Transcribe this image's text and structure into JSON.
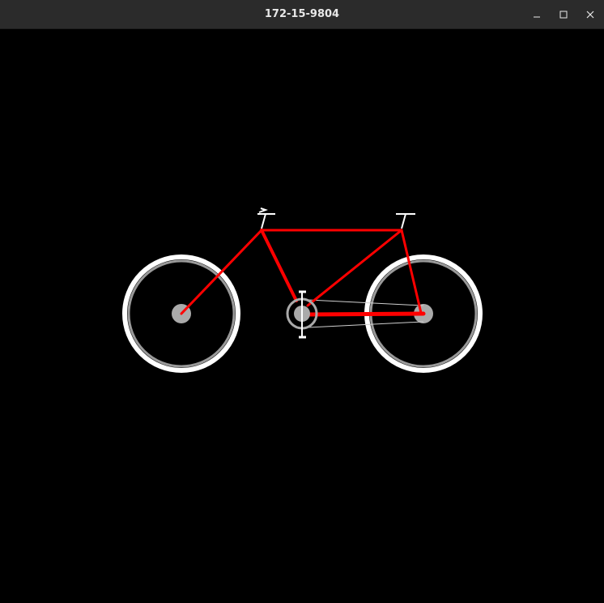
{
  "window": {
    "title": "172-15-9804",
    "controls": {
      "minimize_icon": "minimize-icon",
      "maximize_icon": "maximize-icon",
      "close_icon": "close-icon"
    }
  },
  "colors": {
    "titlebar": "#2b2b2b",
    "title_text": "#e8e8e8",
    "background": "#000000",
    "frame": "#ff0000",
    "tire": "#ffffff",
    "rim": "#999999",
    "hub": "#aaaaaa",
    "chain": "#cfcfcf",
    "parts": "#ffffff"
  }
}
